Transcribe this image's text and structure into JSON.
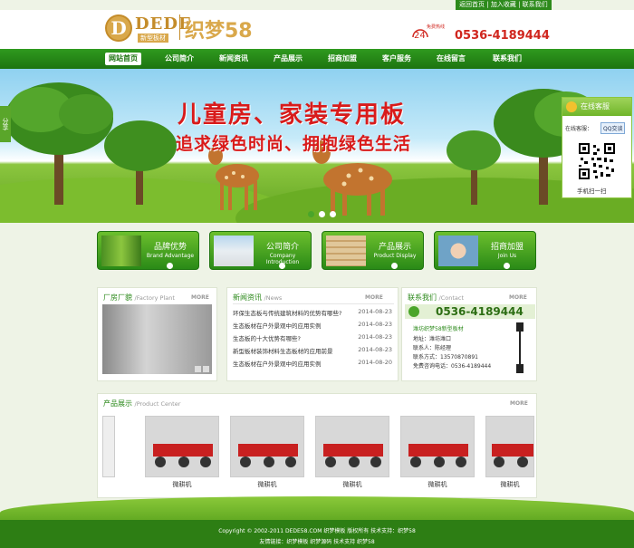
{
  "top_links": {
    "home": "返回首页",
    "sep1": "|",
    "fav": "加入收藏",
    "sep2": "|",
    "contact": "联系我们"
  },
  "logo": {
    "mark": "D",
    "brand": "DEDE",
    "sub": "新型板材",
    "name": "织梦58"
  },
  "hotline": {
    "hours": "24",
    "label": "免费热线",
    "number": "0536-4189444"
  },
  "nav": [
    "网站首页",
    "公司简介",
    "新闻资讯",
    "产品展示",
    "招商加盟",
    "客户服务",
    "在线留言",
    "联系我们"
  ],
  "banner": {
    "title": "儿童房、家装专用板",
    "subtitle": "追求绿色时尚、拥抱绿色生活"
  },
  "share_label": "分享",
  "service": {
    "title": "在线客服",
    "label": "在线客服：",
    "qq": "QQ交谈",
    "scan": "手机扫一扫"
  },
  "features": [
    {
      "title": "品牌优势",
      "en": "Brand Advantage"
    },
    {
      "title": "公司简介",
      "en": "Company Introduction"
    },
    {
      "title": "产品展示",
      "en": "Product Display"
    },
    {
      "title": "招商加盟",
      "en": "Join Us"
    }
  ],
  "factory": {
    "title": "厂房厂貌",
    "en": "/Factory Plant",
    "more": "MORE"
  },
  "news": {
    "title": "新闻资讯",
    "en": "/News",
    "more": "MORE",
    "items": [
      {
        "text": "环保生态板与传统建筑材料的优势有哪些?",
        "date": "2014-08-23"
      },
      {
        "text": "生态板材在户外景观中的应用实例",
        "date": "2014-08-23"
      },
      {
        "text": "生态板的十大优势有哪些?",
        "date": "2014-08-23"
      },
      {
        "text": "新型板材装饰材料生态板材的应用前景",
        "date": "2014-08-23"
      },
      {
        "text": "生态板材在户外景观中的应用实例",
        "date": "2014-08-20"
      }
    ]
  },
  "contact": {
    "title": "联系我们",
    "en": "/Contact",
    "more": "MORE",
    "phone": "0536-4189444",
    "company": "潍坊织梦58新型板材",
    "address": "地址：潍坊潍口",
    "person": "联系人：陈经理",
    "mobile": "联系方式：13570870891",
    "free": "免费咨询电话：0536-4189444"
  },
  "products": {
    "title": "产品展示",
    "en": "/Product Center",
    "more": "MORE",
    "captions": [
      "",
      "微耕机",
      "微耕机",
      "微耕机",
      "微耕机",
      "微耕机"
    ]
  },
  "footer": {
    "line1": "Copyright © 2002-2011 DEDE58.COM 织梦模板 版权所有 技术支持：织梦58",
    "line2": "友情链接：织梦模板 织梦源码 技术支持 织梦58"
  },
  "colors": {
    "primary": "#2d8a1c",
    "accent": "#d81b1b",
    "gold": "#d9a84b"
  }
}
